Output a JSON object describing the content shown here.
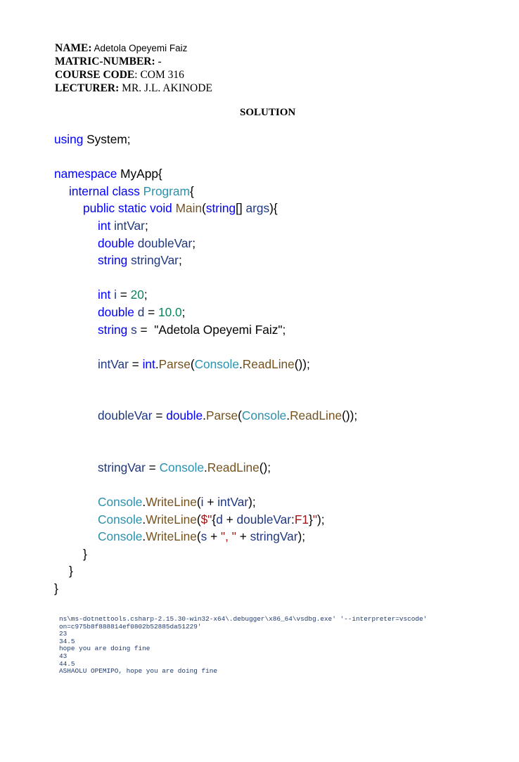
{
  "header": {
    "name_label": "NAME:",
    "name_value": " Adetola Opeyemi Faiz",
    "matric_label": "MATRIC-NUMBER:",
    "matric_value": " -",
    "course_label": "COURSE CODE",
    "course_value": ": COM 316",
    "lecturer_label": "LECTURER:",
    "lecturer_value": " MR. J.L. AKINODE"
  },
  "solution_title": "SOLUTION",
  "code": {
    "l1_kw": "using",
    "l1_rest": " System;",
    "l2_kw": "namespace",
    "l2_rest": " MyApp{",
    "l3_kw": "internal class",
    "l3_type": " Program",
    "l3_brace": "{",
    "l4_kw": "public static void",
    "l4_method": " Main",
    "l4_open": "(",
    "l4_type": "string",
    "l4_brackets": "[]",
    "l4_param": " args",
    "l4_close": "){",
    "l5_kw": "int",
    "l5_var": " intVar",
    "l5_semi": ";",
    "l6_kw": "double",
    "l6_var": " doubleVar",
    "l6_semi": ";",
    "l7_kw": "string",
    "l7_var": " stringVar",
    "l7_semi": ";",
    "l8_kw": "int",
    "l8_var": " i",
    "l8_eq": " = ",
    "l8_num": "20",
    "l8_semi": ";",
    "l9_kw": "double",
    "l9_var": " d",
    "l9_eq": " = ",
    "l9_num": "10.0",
    "l9_semi": ";",
    "l10_kw": "string",
    "l10_var": " s",
    "l10_eq": " =  ",
    "l10_str": "\"Adetola Opeyemi Faiz\";",
    "l11_var": "intVar",
    "l11_eq": " = ",
    "l11_kw": "int",
    "l11_dot": ".",
    "l11_method": "Parse",
    "l11_open": "(",
    "l11_type": "Console",
    "l11_dot2": ".",
    "l11_method2": "ReadLine",
    "l11_close": "());",
    "l12_var": "doubleVar",
    "l12_eq": " = ",
    "l12_kw": "double",
    "l12_dot": ".",
    "l12_method": "Parse",
    "l12_open": "(",
    "l12_type": "Console",
    "l12_dot2": ".",
    "l12_method2": "ReadLine",
    "l12_close": "());",
    "l13_var": "stringVar",
    "l13_eq": " = ",
    "l13_type": "Console",
    "l13_dot": ".",
    "l13_method": "ReadLine",
    "l13_close": "();",
    "l14_type": "Console",
    "l14_dot": ".",
    "l14_method": "WriteLine",
    "l14_open": "(",
    "l14_var": "i",
    "l14_plus": " + ",
    "l14_var2": "intVar",
    "l14_close": ");",
    "l15_type": "Console",
    "l15_dot": ".",
    "l15_method": "WriteLine",
    "l15_open": "(",
    "l15_str1": "$\"",
    "l15_brace1": "{",
    "l15_var": "d",
    "l15_plus": " + ",
    "l15_var2": "doubleVar",
    "l15_colon": ":",
    "l15_fmt": "F1",
    "l15_brace2": "}",
    "l15_str2": "\"",
    "l15_close": ");",
    "l16_type": "Console",
    "l16_dot": ".",
    "l16_method": "WriteLine",
    "l16_open": "(",
    "l16_var": "s",
    "l16_plus": " + ",
    "l16_str": "\", \"",
    "l16_plus2": " + ",
    "l16_var2": "stringVar",
    "l16_close": ");",
    "close_method": "}",
    "close_class": "}",
    "close_ns": "}"
  },
  "console_output": {
    "line1": "ns\\ms-dotnettools.csharp-2.15.30-win32-x64\\.debugger\\x86_64\\vsdbg.exe' '--interpreter=vscode'",
    "line2": "on=c975b8f888814ef0802b52885da51229'",
    "line3": "23",
    "line4": "34.5",
    "line5": "hope you are doing fine",
    "line6": "43",
    "line7": "44.5",
    "line8": "ASHAOLU OPEMIPO, hope you are doing fine"
  }
}
